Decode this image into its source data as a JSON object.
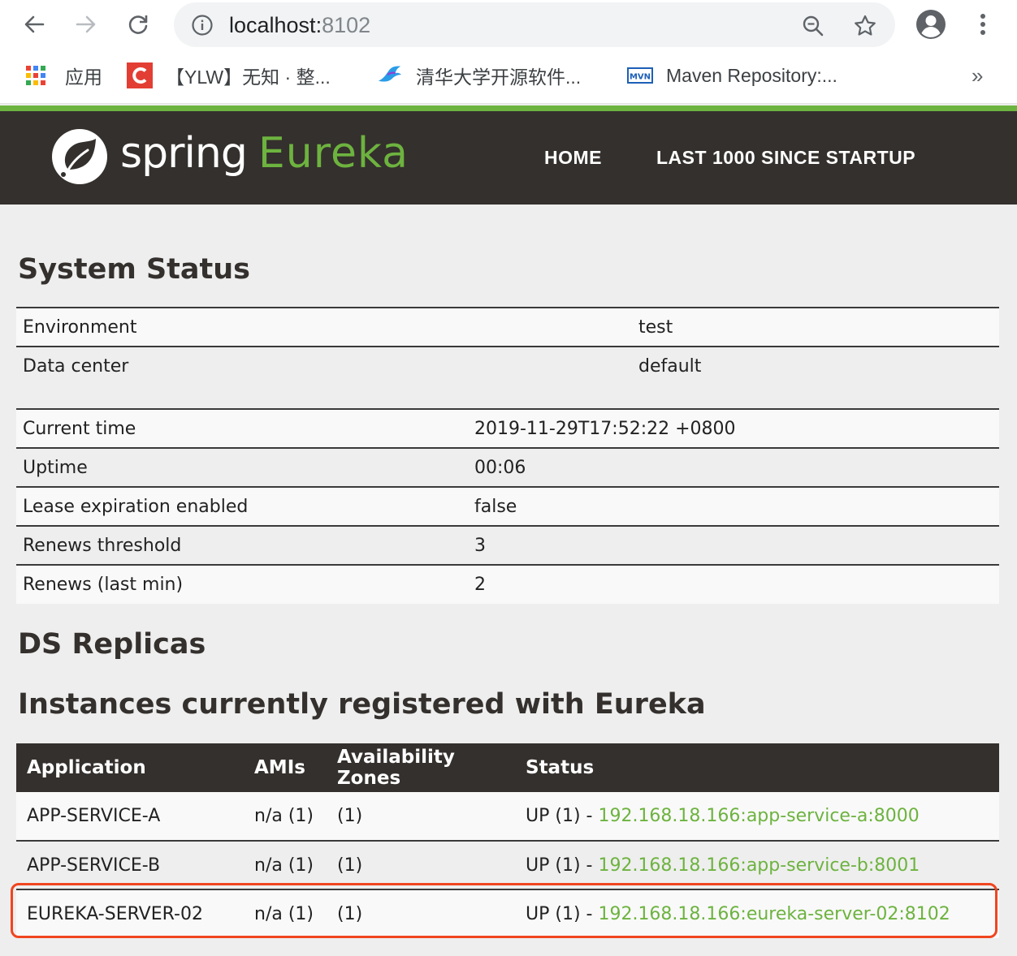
{
  "browser": {
    "url_host": "localhost:",
    "url_port": "8102",
    "bookmarks": [
      {
        "icon": "apps-grid-icon",
        "label": "应用"
      },
      {
        "icon": "csdn-icon",
        "label": "【YLW】无知 · 整..."
      },
      {
        "icon": "bird-icon",
        "label": "清华大学开源软件..."
      },
      {
        "icon": "mvn-icon",
        "label": "Maven Repository:..."
      }
    ],
    "more_label": "»"
  },
  "navbar": {
    "brand_spring": "spring",
    "brand_eureka": "Eureka",
    "home_label": "HOME",
    "last1000_label": "LAST 1000 SINCE STARTUP"
  },
  "system_status": {
    "title": "System Status",
    "env_rows": [
      {
        "key": "Environment",
        "value": "test"
      },
      {
        "key": "Data center",
        "value": "default"
      }
    ],
    "stat_rows": [
      {
        "key": "Current time",
        "value": "2019-11-29T17:52:22 +0800"
      },
      {
        "key": "Uptime",
        "value": "00:06"
      },
      {
        "key": "Lease expiration enabled",
        "value": "false"
      },
      {
        "key": "Renews threshold",
        "value": "3"
      },
      {
        "key": "Renews (last min)",
        "value": "2"
      }
    ]
  },
  "ds_replicas": {
    "title": "DS Replicas"
  },
  "instances": {
    "title": "Instances currently registered with Eureka",
    "headers": [
      "Application",
      "AMIs",
      "Availability Zones",
      "Status"
    ],
    "rows": [
      {
        "application": "APP-SERVICE-A",
        "amis": "n/a (1)",
        "zones": "(1)",
        "status_prefix": "UP (1) - ",
        "link": "192.168.18.166:app-service-a:8000"
      },
      {
        "application": "APP-SERVICE-B",
        "amis": "n/a (1)",
        "zones": "(1)",
        "status_prefix": "UP (1) - ",
        "link": "192.168.18.166:app-service-b:8001"
      },
      {
        "application": "EUREKA-SERVER-02",
        "amis": "n/a (1)",
        "zones": "(1)",
        "status_prefix": "UP (1) - ",
        "link": "192.168.18.166:eureka-server-02:8102"
      }
    ]
  },
  "colors": {
    "brand_green": "#6db33f",
    "navbar_dark": "#34302d",
    "highlight_red": "#f0451f"
  }
}
